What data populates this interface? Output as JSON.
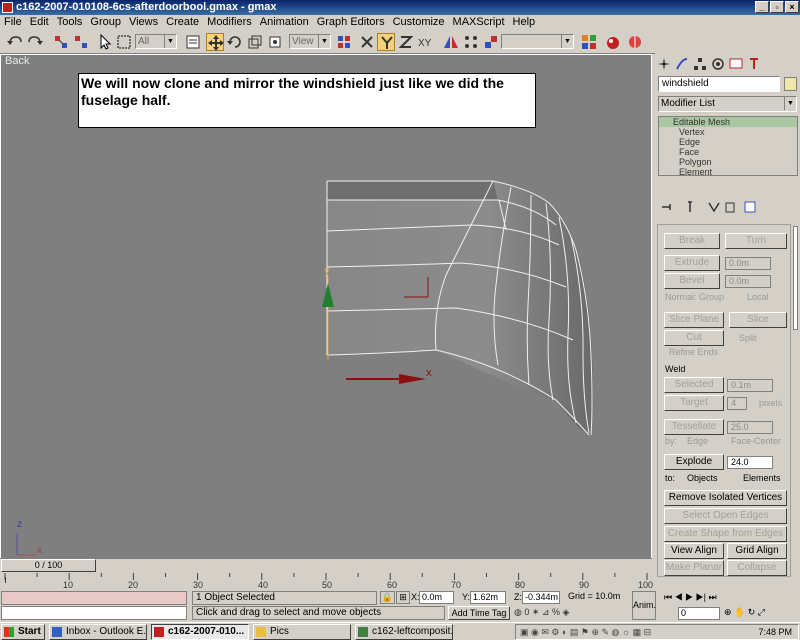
{
  "window": {
    "title": "c162-2007-010108-6cs-afterdoorbool.gmax - gmax"
  },
  "menu": [
    "File",
    "Edit",
    "Tools",
    "Group",
    "Views",
    "Create",
    "Modifiers",
    "Animation",
    "Graph Editors",
    "Customize",
    "MAXScript",
    "Help"
  ],
  "toolbar": {
    "selection_filter": "All",
    "ref_coord": "View"
  },
  "viewport": {
    "label": "Back",
    "note": "We will now clone and mirror the windshield just like we did the fuselage half.",
    "axis_y": "y",
    "axis_x": "x",
    "corner_z": "z",
    "corner_x": "x"
  },
  "command_panel": {
    "object_name": "windshield",
    "name_color": "#f0e6a8",
    "modifier_list": "Modifier List",
    "stack": {
      "root": "Editable Mesh",
      "items": [
        "Vertex",
        "Edge",
        "Face",
        "Polygon",
        "Element"
      ]
    },
    "edit_geometry": {
      "break": "Break",
      "turn": "Turn",
      "extrude": "Extrude",
      "extrude_val": "0.0m",
      "bevel": "Bevel",
      "bevel_val": "0.0m",
      "normal": "Normal:",
      "group": "Group",
      "local": "Local",
      "slice_plane": "Slice Plane",
      "slice": "Slice",
      "cut": "Cut",
      "split": "Split",
      "refine_ends": "Refine Ends",
      "weld": "Weld",
      "selected": "Selected",
      "selected_val": "0.1m",
      "target": "Target",
      "target_val": "4",
      "pixels": "pixels",
      "tessellate": "Tessellate",
      "tessellate_val": "25.0",
      "by": "by:",
      "edge": "Edge",
      "face_center": "Face-Center",
      "explode": "Explode",
      "explode_val": "24.0",
      "to": "to:",
      "objects": "Objects",
      "elements": "Elements",
      "remove_isolated": "Remove Isolated Vertices",
      "select_open_edges": "Select Open Edges",
      "create_shape": "Create Shape from Edges",
      "view_align": "View Align",
      "grid_align": "Grid Align",
      "make_planar": "Make Planar",
      "collapse": "Collapse"
    }
  },
  "timeline": {
    "frame": "0 / 100",
    "ticks": [
      "10",
      "20",
      "30",
      "40",
      "50",
      "60",
      "70",
      "80",
      "90",
      "100"
    ]
  },
  "status": {
    "selected": "1 Object Selected",
    "prompt": "Click and drag to select and move objects",
    "x_label": "X:",
    "x_val": "0.0m",
    "y_label": "Y:",
    "y_val": "1.62m",
    "z_label": "Z:",
    "z_val": "-0.344m",
    "grid": "Grid = 10.0m",
    "add_time_tag": "Add Time Tag",
    "anim": "Anim.",
    "frame_field": "0"
  },
  "taskbar": {
    "start": "Start",
    "tasks": [
      "Inbox - Outlook E...",
      "c162-2007-010...",
      "Pics",
      "c162-leftcomposit..."
    ],
    "clock": "7:48 PM"
  }
}
